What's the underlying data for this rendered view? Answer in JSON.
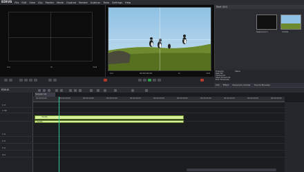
{
  "app": {
    "name": "EDIUS"
  },
  "menu": [
    "File",
    "Edit",
    "View",
    "Clip",
    "Marker",
    "Mode",
    "Capture",
    "Render",
    "Autorun",
    "Tools",
    "Settings",
    "Help"
  ],
  "player": {
    "labels": [
      "Cur",
      "In",
      "Out",
      "Dur"
    ],
    "timecode": "00:00:00;00"
  },
  "recorder": {
    "labels": [
      "Cur",
      "In",
      "Out",
      "Dur"
    ],
    "timecode": "00:00:00;00"
  },
  "bin": {
    "title": "Root (0/1)",
    "items": [
      {
        "label": "Sequence 1",
        "color": "#111111"
      },
      {
        "label": "mov0s",
        "color": "#7aa04a"
      }
    ]
  },
  "properties": {
    "rows": [
      {
        "key": "Property",
        "value": "Value"
      },
      {
        "key": "Reel No",
        "value": ""
      },
      {
        "key": "Comment",
        "value": ""
      },
      {
        "key": "Start Timecode",
        "value": ""
      },
      {
        "key": "End Timecode",
        "value": ""
      }
    ],
    "tabs": [
      "Info",
      "Effect",
      "Sequence marker",
      "Source Browser"
    ]
  },
  "timeline": {
    "project_name": "EDIUS",
    "project_label": "Untitled",
    "sequence_tab": "Sequence1",
    "ruler_labels": [
      "00:00:00;00",
      "00:00:05;00",
      "00:00:10;00",
      "00:00:15;00",
      "00:00:20;00",
      "00:00:25;00",
      "00:00:30;00",
      "00:00:35;00",
      "00:00:40;00",
      "00:00:45;00",
      "00:00:50;00"
    ],
    "tracks": [
      "1 V",
      "1 VA",
      "",
      "1 A",
      "2 A",
      "3 A",
      "4 A"
    ],
    "clips": [
      {
        "name": "mov0s",
        "track": "video"
      },
      {
        "name": "mov0s",
        "track": "audio"
      }
    ]
  },
  "colors": {
    "clip_fill": "#d7ef9c",
    "playhead": "#2ecf8f",
    "accent": "#b33a2c"
  }
}
